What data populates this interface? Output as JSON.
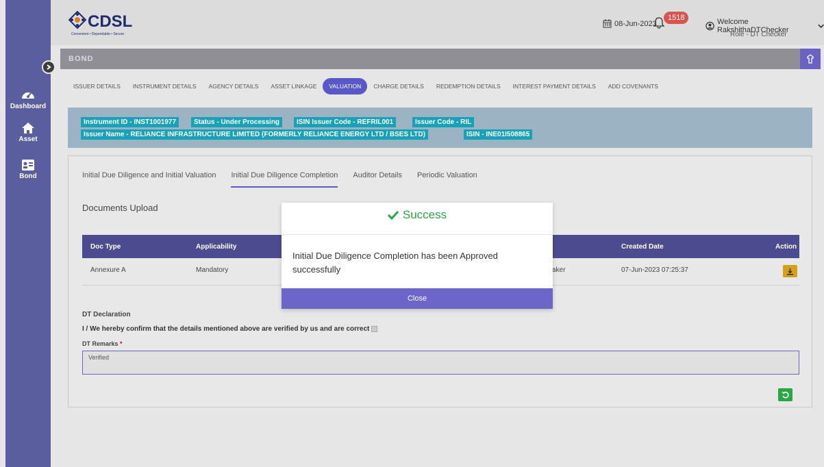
{
  "sidebar": {
    "items": [
      {
        "label": "Dashboard",
        "icon": "dashboard-icon"
      },
      {
        "label": "Asset",
        "icon": "home-icon"
      },
      {
        "label": "Bond",
        "icon": "id-card-icon"
      }
    ]
  },
  "header": {
    "logo_text": "CDSL",
    "logo_tagline": "Convenient • Dependable • Secure",
    "date": "08-Jun-2023",
    "notification_count": "1518",
    "welcome": "Welcome RakshithaDTChecker",
    "role": "Role - DT Checker"
  },
  "section": {
    "title": "BOND"
  },
  "tabs": [
    {
      "label": "ISSUER DETAILS",
      "active": false
    },
    {
      "label": "INSTRUMENT DETAILS",
      "active": false
    },
    {
      "label": "AGENCY DETAILS",
      "active": false
    },
    {
      "label": "ASSET LINKAGE",
      "active": false
    },
    {
      "label": "VALUATION",
      "active": true
    },
    {
      "label": "CHARGE DETAILS",
      "active": false
    },
    {
      "label": "REDEMPTION DETAILS",
      "active": false
    },
    {
      "label": "INTEREST PAYMENT DETAILS",
      "active": false
    },
    {
      "label": "ADD COVENANTS",
      "active": false
    }
  ],
  "info": {
    "instrument_id": "Instrument ID - INST1001977",
    "status": "Status - Under Processing",
    "isin_issuer_code": "ISIN Issuer Code - REFRIL001",
    "issuer_code": "Issuer Code - RIL",
    "issuer_name": "Issuer Name - RELIANCE INFRASTRUCTURE LIMITED (FORMERLY RELIANCE ENERGY LTD / BSES LTD)",
    "isin": "ISIN - INE01I508865"
  },
  "subtabs": [
    {
      "label": "Initial Due Diligence and Initial Valuation",
      "active": false
    },
    {
      "label": "Initial Due Diligence Completion",
      "active": true
    },
    {
      "label": "Auditor Details",
      "active": false
    },
    {
      "label": "Periodic Valuation",
      "active": false
    }
  ],
  "documents": {
    "title": "Documents Upload",
    "columns": [
      "Doc Type",
      "Applicability",
      "Created Date",
      "Action"
    ],
    "rows": [
      {
        "doc_type": "Annexure A",
        "applicability": "Mandatory",
        "created_by_partial": "aker",
        "created_date": "07-Jun-2023 07:25:37"
      }
    ]
  },
  "declaration": {
    "title": "DT Declaration",
    "text": "I / We hereby confirm that the details mentioned above are verified by us and are correct",
    "remarks_label": "DT Remarks",
    "required_mark": "*",
    "remarks_value": "Verified"
  },
  "modal": {
    "title": "Success",
    "message": "Initial Due Diligence Completion has been Approved successfully",
    "close_label": "Close"
  },
  "colors": {
    "sidebar": "#5a5d9e",
    "accent": "#6b63c4",
    "success": "#28a745",
    "badge": "#17a2b8",
    "download": "#d4a017"
  }
}
